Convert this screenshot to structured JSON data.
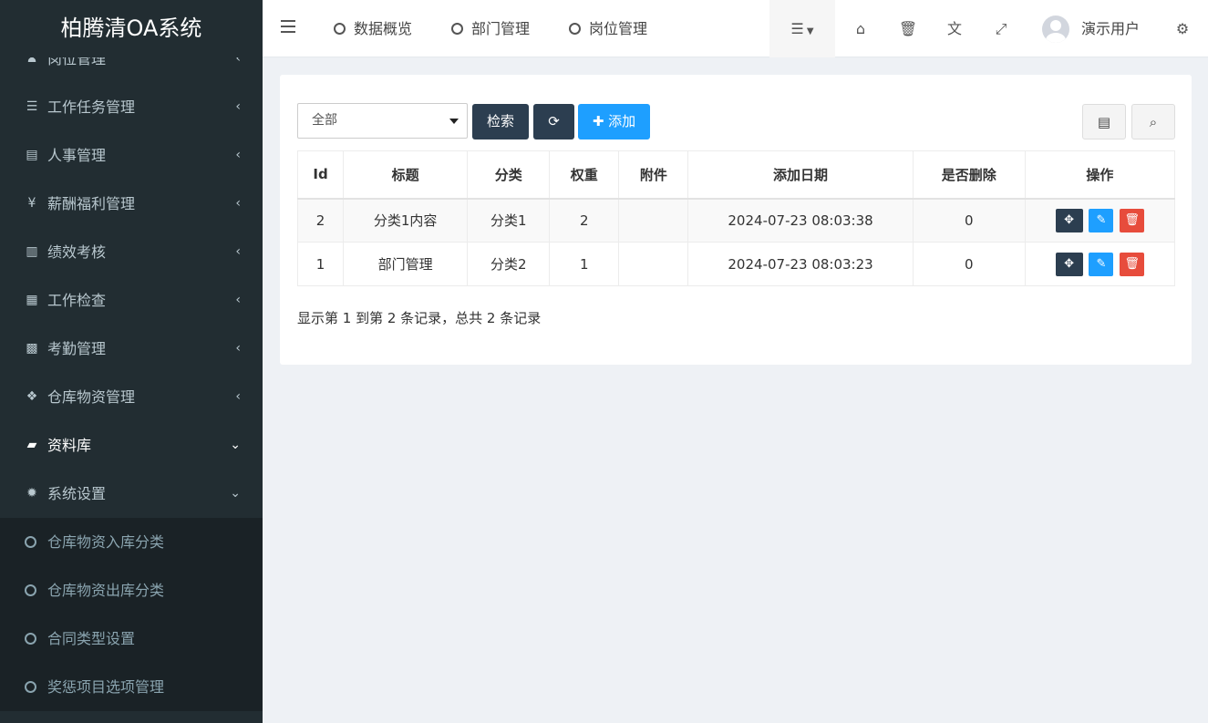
{
  "app": {
    "title": "柏腾清OA系统"
  },
  "sidebar": {
    "items": [
      {
        "label": "岗位管理",
        "icon": "sitemap-icon",
        "chevron": "‹"
      },
      {
        "label": "工作任务管理",
        "icon": "list-icon",
        "chevron": "‹"
      },
      {
        "label": "人事管理",
        "icon": "id-card-icon",
        "chevron": "‹"
      },
      {
        "label": "薪酬福利管理",
        "icon": "yen-icon",
        "chevron": "‹"
      },
      {
        "label": "绩效考核",
        "icon": "bar-chart-icon",
        "chevron": "‹"
      },
      {
        "label": "工作检查",
        "icon": "calculator-icon",
        "chevron": "‹"
      },
      {
        "label": "考勤管理",
        "icon": "calendar-icon",
        "chevron": "‹"
      },
      {
        "label": "仓库物资管理",
        "icon": "cubes-icon",
        "chevron": "‹"
      },
      {
        "label": "资料库",
        "icon": "book-icon",
        "chevron": "⌄"
      },
      {
        "label": "系统设置",
        "icon": "gear-icon",
        "chevron": "⌄"
      }
    ],
    "subitems": [
      {
        "label": "仓库物资入库分类"
      },
      {
        "label": "仓库物资出库分类"
      },
      {
        "label": "合同类型设置"
      },
      {
        "label": "奖惩项目选项管理"
      }
    ]
  },
  "header": {
    "tabs": [
      {
        "label": "数据概览"
      },
      {
        "label": "部门管理"
      },
      {
        "label": "岗位管理"
      }
    ],
    "user_name": "演示用户"
  },
  "toolbar": {
    "filter_value": "全部",
    "search_label": "检索",
    "add_label": "添加"
  },
  "table": {
    "columns": [
      "Id",
      "标题",
      "分类",
      "权重",
      "附件",
      "添加日期",
      "是否删除",
      "操作"
    ],
    "rows": [
      {
        "id": "2",
        "title": "分类1内容",
        "category": "分类1",
        "weight": "2",
        "attachment": "",
        "date": "2024-07-23 08:03:38",
        "deleted": "0"
      },
      {
        "id": "1",
        "title": "部门管理",
        "category": "分类2",
        "weight": "1",
        "attachment": "",
        "date": "2024-07-23 08:03:23",
        "deleted": "0"
      }
    ],
    "summary": "显示第 1 到第 2 条记录，总共 2 条记录"
  },
  "colors": {
    "sidebar_bg": "#222d32",
    "submenu_bg": "#1a2226",
    "primary_dark": "#2c3e50",
    "primary_blue": "#1e9fff",
    "danger": "#e74c3c"
  }
}
